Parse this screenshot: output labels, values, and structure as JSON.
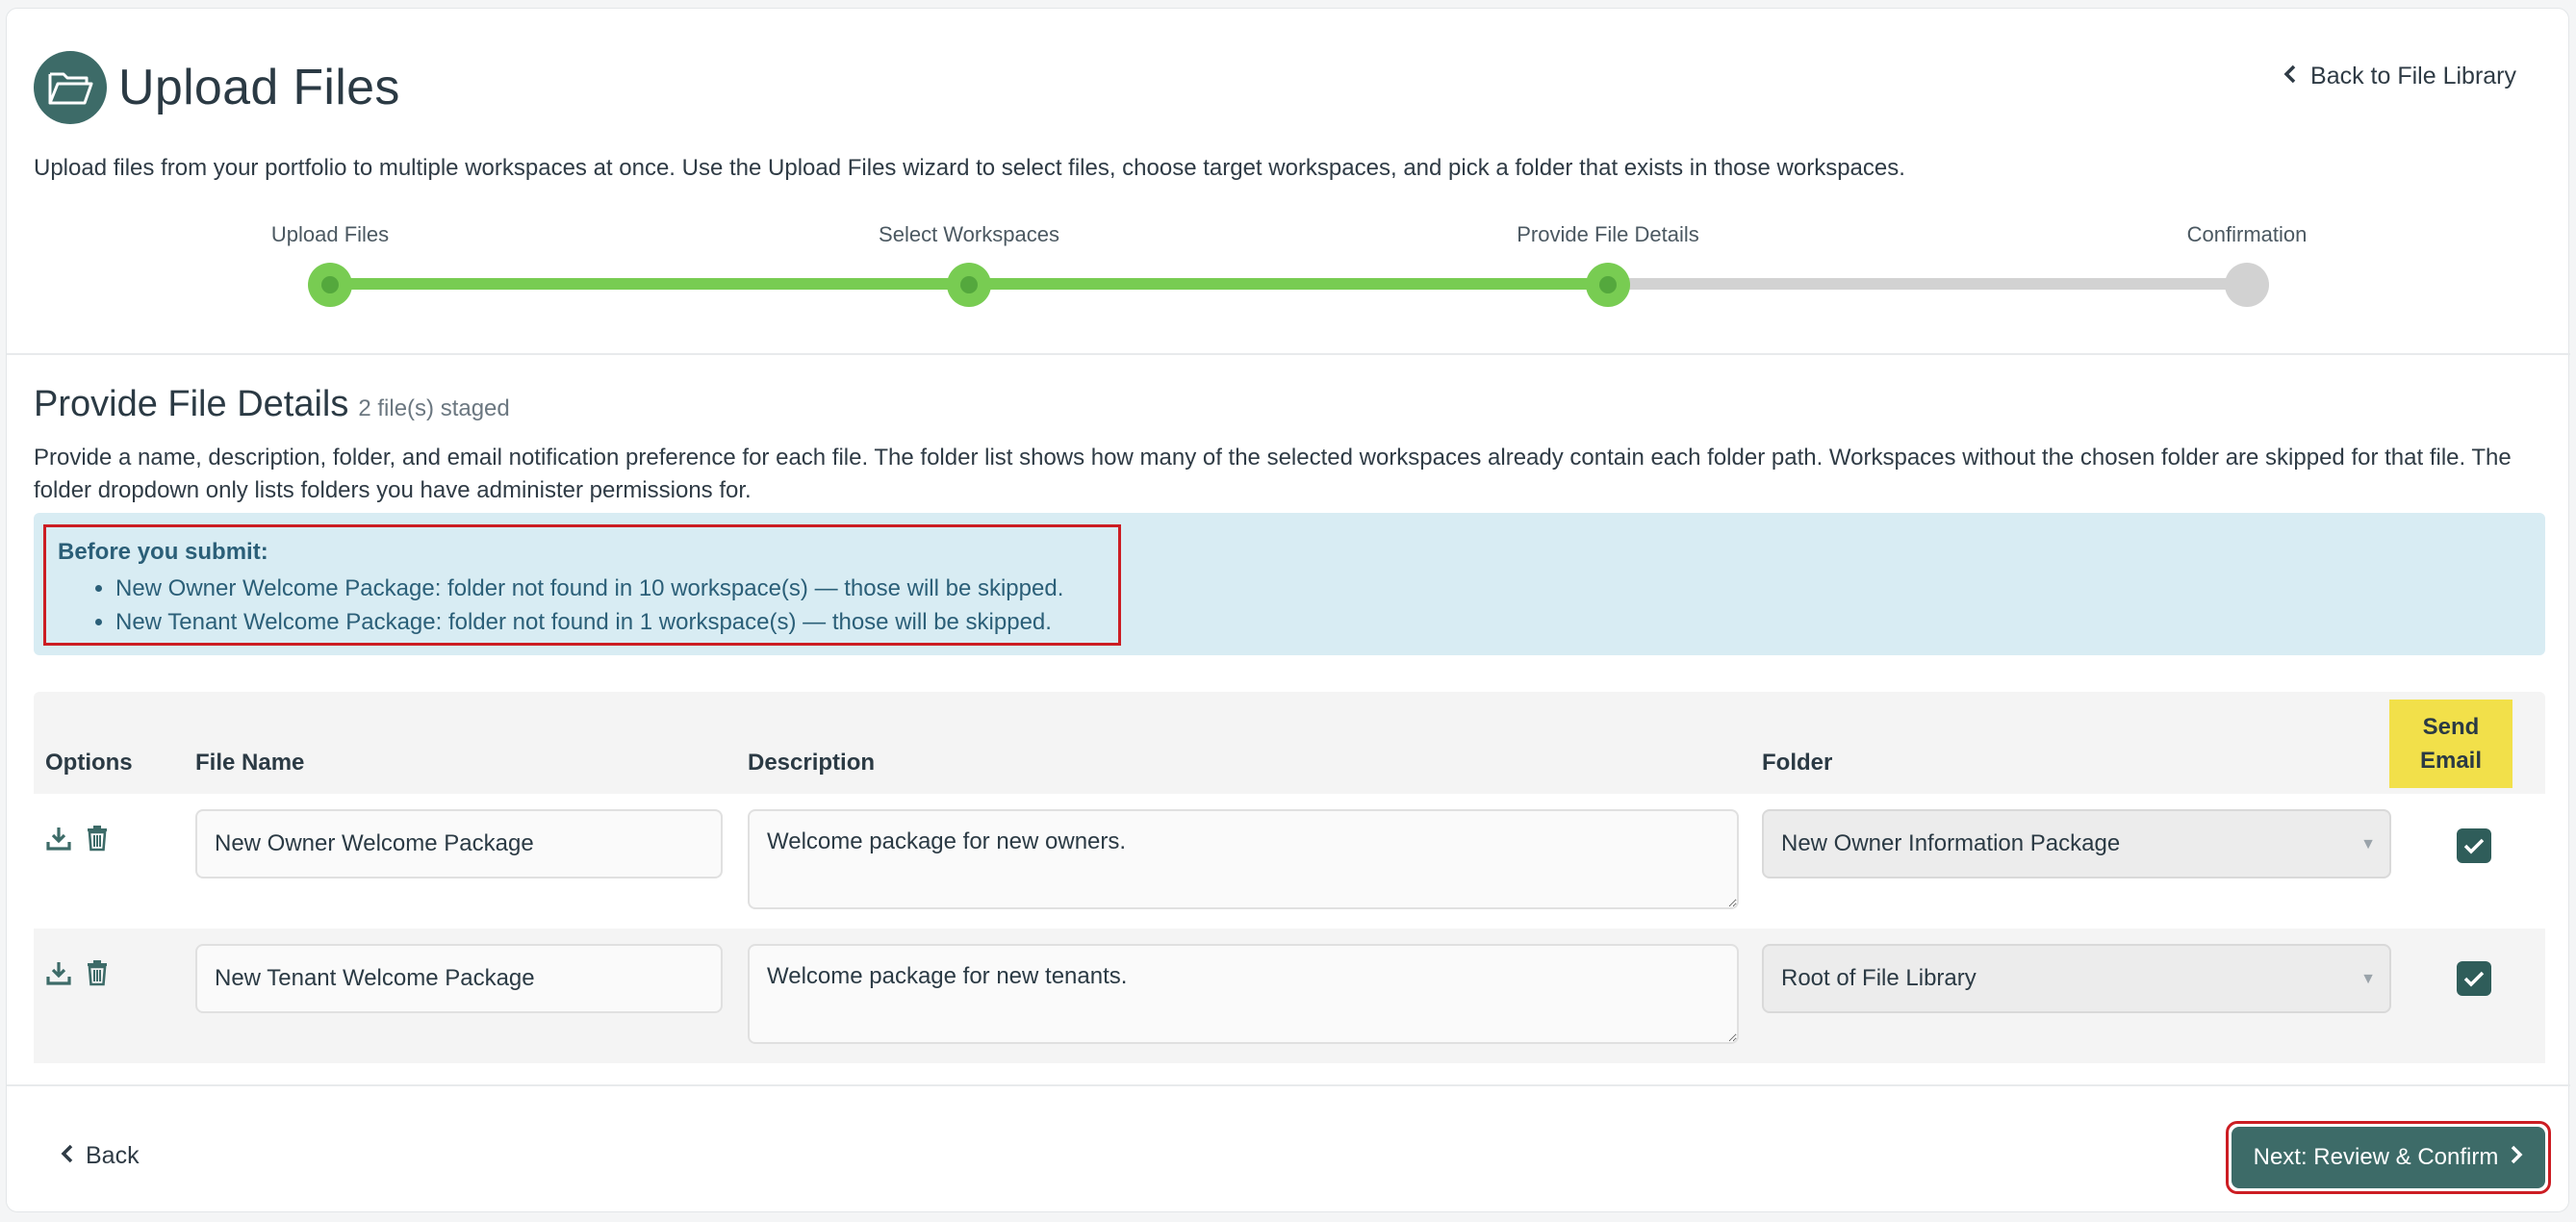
{
  "header": {
    "title": "Upload Files",
    "back_link": "Back to File Library",
    "intro": "Upload files from your portfolio to multiple workspaces at once. Use the Upload Files wizard to select files, choose target workspaces, and pick a folder that exists in those workspaces."
  },
  "stepper": {
    "steps": [
      {
        "label": "Upload Files",
        "status": "complete"
      },
      {
        "label": "Select Workspaces",
        "status": "complete"
      },
      {
        "label": "Provide File Details",
        "status": "current"
      },
      {
        "label": "Confirmation",
        "status": "pending"
      }
    ]
  },
  "section": {
    "title": "Provide File Details",
    "staged": "2 file(s) staged",
    "description": "Provide a name, description, folder, and email notification preference for each file. The folder list shows how many of the selected workspaces already contain each folder path. Workspaces without the chosen folder are skipped for that file. The folder dropdown only lists folders you have administer permissions for."
  },
  "alert": {
    "title": "Before you submit:",
    "items": [
      "New Owner Welcome Package: folder not found in 10 workspace(s) — those will be skipped.",
      "New Tenant Welcome Package: folder not found in 1 workspace(s) — those will be skipped."
    ]
  },
  "table": {
    "headers": {
      "options": "Options",
      "file_name": "File Name",
      "description": "Description",
      "folder": "Folder",
      "send_email": "Send Email"
    },
    "rows": [
      {
        "file_name": "New Owner Welcome Package",
        "description": "Welcome package for new owners.",
        "folder": "New Owner Information Package",
        "send_email": true
      },
      {
        "file_name": "New Tenant Welcome Package",
        "description": "Welcome package for new tenants.",
        "folder": "Root of File Library",
        "send_email": true
      }
    ]
  },
  "footer": {
    "back_label": "Back",
    "next_label": "Next: Review & Confirm"
  },
  "colors": {
    "primary": "#3d6b68",
    "step_complete": "#78cc52",
    "step_pending": "#d2d2d2",
    "alert_bg": "#d8ecf3",
    "highlight_border": "#cc1d23",
    "send_email_header": "#f2e04a"
  },
  "icons": [
    "folder-open-icon",
    "chevron-left-icon",
    "download-icon",
    "trash-icon",
    "check-icon",
    "chevron-right-icon",
    "caret-down-icon"
  ]
}
